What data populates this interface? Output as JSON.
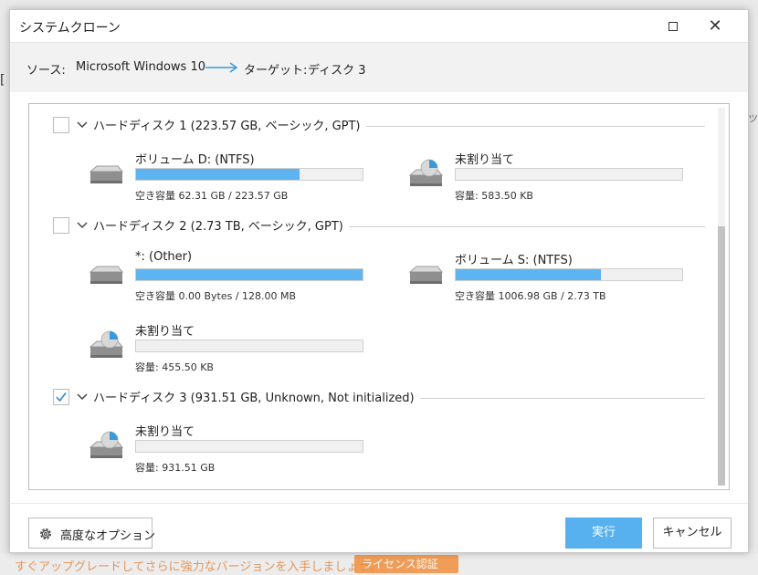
{
  "dialog": {
    "title": "システムクローン",
    "source_label": "ソース:",
    "source_value": "Microsoft Windows 10",
    "target_label": "ターゲット:",
    "target_value": "ディスク 3"
  },
  "disks": [
    {
      "label": "ハードディスク 1 (223.57 GB, ベーシック, GPT)",
      "checked": false,
      "partitions": [
        {
          "name": "ボリューム D: (NTFS)",
          "capacity": "空き容量 62.31 GB / 223.57 GB",
          "used_fraction": 0.72,
          "icon": "drive-icon"
        },
        {
          "name": "未割り当て",
          "capacity": "容量: 583.50 KB",
          "used_fraction": 0,
          "icon": "unallocated-drive-icon"
        }
      ]
    },
    {
      "label": "ハードディスク 2 (2.73 TB, ベーシック, GPT)",
      "checked": false,
      "partitions": [
        {
          "name": "*: (Other)",
          "capacity": "空き容量 0.00 Bytes / 128.00 MB",
          "used_fraction": 1.0,
          "icon": "drive-icon"
        },
        {
          "name": "ボリューム S: (NTFS)",
          "capacity": "空き容量 1006.98 GB / 2.73 TB",
          "used_fraction": 0.64,
          "icon": "drive-icon"
        },
        {
          "name": "未割り当て",
          "capacity": "容量: 455.50 KB",
          "used_fraction": 0,
          "icon": "unallocated-drive-icon"
        }
      ]
    },
    {
      "label": "ハードディスク 3 (931.51 GB, Unknown, Not initialized)",
      "checked": true,
      "partitions": [
        {
          "name": "未割り当て",
          "capacity": "容量: 931.51 GB",
          "used_fraction": 0,
          "icon": "unallocated-drive-icon"
        }
      ]
    }
  ],
  "footer": {
    "advanced_label": "高度なオプション",
    "run_label": "実行",
    "cancel_label": "キャンセル"
  },
  "background": {
    "notice_text": "すぐアップグレードしてさらに強力なバージョンを入手しましょう。",
    "badge_text": "ライセンス認証"
  },
  "colors": {
    "accent": "#57b1ee",
    "bar_fill": "#5db4f0",
    "checkmark": "#2b8ad8"
  }
}
